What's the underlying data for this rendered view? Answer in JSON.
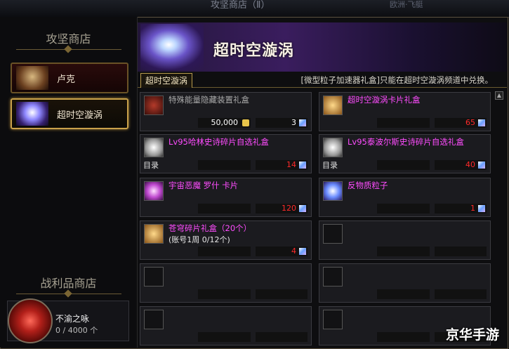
{
  "topbar": {
    "title": "攻坚商店（Ⅱ）",
    "right_text": "欧洲·飞艇"
  },
  "left": {
    "siege_title": "攻坚商店",
    "shops": [
      {
        "label": "卢克",
        "selected": false
      },
      {
        "label": "超时空漩涡",
        "selected": true
      }
    ],
    "loot_title": "战利品商店",
    "reward": {
      "name": "不渝之咏",
      "count": "0 / 4000 个"
    }
  },
  "banner": {
    "title": "超时空漩涡"
  },
  "tab": {
    "label": "超时空漩涡"
  },
  "notice": "[微型粒子加速器礼盒]只能在超时空漩涡频道中兑换。",
  "scroll": {
    "up_glyph": "▲"
  },
  "items": [
    {
      "name": "特殊能量隐藏装置礼盒",
      "name_color": "#a9a9a9",
      "line2": "",
      "tag": "",
      "price": "50,000",
      "qty": "3",
      "qty_color": "white"
    },
    {
      "name": "超时空漩涡卡片礼盒",
      "name_color": "#ff4cff",
      "line2": "",
      "tag": "",
      "price": "",
      "qty": "65",
      "qty_color": "red"
    },
    {
      "name": "Lv95哈林史诗碎片自选礼盒",
      "name_color": "#ff4cff",
      "line2": "",
      "tag": "目录",
      "price": "",
      "qty": "14",
      "qty_color": "red"
    },
    {
      "name": "Lv95泰波尔斯史诗碎片自选礼盒",
      "name_color": "#ff4cff",
      "line2": "",
      "tag": "目录",
      "price": "",
      "qty": "40",
      "qty_color": "red"
    },
    {
      "name": "宇宙恶魔 罗什 卡片",
      "name_color": "#ff4cff",
      "line2": "",
      "tag": "",
      "price": "",
      "qty": "120",
      "qty_color": "red"
    },
    {
      "name": "反物质粒子",
      "name_color": "#ff4cff",
      "line2": "",
      "tag": "",
      "price": "",
      "qty": "1",
      "qty_color": "red"
    },
    {
      "name": "苍穹碎片礼盒（20个）",
      "name_color": "#ff4cff",
      "line2": "(账号1周 0/12个)",
      "tag": "",
      "price": "",
      "qty": "4",
      "qty_color": "red"
    }
  ],
  "watermark": "京华手游"
}
